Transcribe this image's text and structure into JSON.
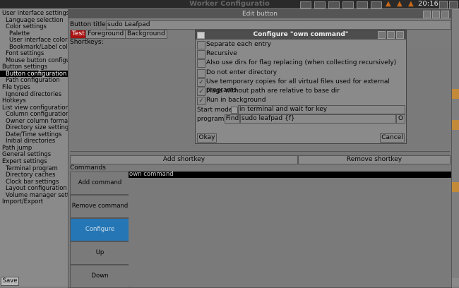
{
  "taskbar": {
    "window_title": "Worker Configuratio",
    "clock": "20:16"
  },
  "worker_config": {
    "tree": [
      {
        "label": "User interface settings",
        "indent": 0
      },
      {
        "label": "Language selection",
        "indent": 1
      },
      {
        "label": "Color settings",
        "indent": 1
      },
      {
        "label": "Palette",
        "indent": 2
      },
      {
        "label": "User interface colors",
        "indent": 2
      },
      {
        "label": "Bookmark/Label colo",
        "indent": 2
      },
      {
        "label": "Font settings",
        "indent": 1
      },
      {
        "label": "Mouse button configu",
        "indent": 1
      },
      {
        "label": "Button settings",
        "indent": 0
      },
      {
        "label": "Button configuration",
        "indent": 1,
        "selected": true
      },
      {
        "label": "Path configuration",
        "indent": 1
      },
      {
        "label": "File types",
        "indent": 0
      },
      {
        "label": "Ignored directories",
        "indent": 1
      },
      {
        "label": "Hotkeys",
        "indent": 0
      },
      {
        "label": "List view configuration",
        "indent": 0
      },
      {
        "label": "Column configuration",
        "indent": 1
      },
      {
        "label": "Owner column forma",
        "indent": 1
      },
      {
        "label": "Directory size setting",
        "indent": 1
      },
      {
        "label": "Date/Time settings",
        "indent": 1
      },
      {
        "label": "Initial directories",
        "indent": 1
      },
      {
        "label": "Path jump",
        "indent": 0
      },
      {
        "label": "General settings",
        "indent": 0
      },
      {
        "label": "Expert settings",
        "indent": 0
      },
      {
        "label": "Terminal program",
        "indent": 1
      },
      {
        "label": "Directory caches",
        "indent": 1
      },
      {
        "label": "Clock bar settings",
        "indent": 1
      },
      {
        "label": "Layout configuration",
        "indent": 1
      },
      {
        "label": "Volume manager sett",
        "indent": 1
      },
      {
        "label": "Import/Export",
        "indent": 0
      }
    ],
    "save_label": "Save"
  },
  "edit_button": {
    "title": "Edit button",
    "button_title_label": "Button title:",
    "button_title_value": "sudo Leafpad",
    "tabs": [
      "Test",
      "Foreground",
      "Background"
    ],
    "shortkeys_label": "Shortkeys:",
    "add_shortkey": "Add shortkey",
    "remove_shortkey": "Remove shortkey",
    "commands_label": "Commands",
    "command_buttons": [
      "Add command",
      "Remove command",
      "Configure",
      "Up",
      "Down"
    ],
    "commands": [
      "own command"
    ]
  },
  "own_command": {
    "title": "Configure \"own command\"",
    "options": [
      {
        "label": "Separate each entry",
        "checked": false
      },
      {
        "label": "Recursive",
        "checked": false
      },
      {
        "label": "Also use dirs for flag replacing (when collecting recursively)",
        "checked": false
      },
      {
        "label": "Do not enter directory",
        "checked": false
      },
      {
        "label": "Use temporary copies for all virtual files used for external programs",
        "checked": true
      },
      {
        "label": "Flags without path are relative to base dir",
        "checked": true
      },
      {
        "label": "Run in background",
        "checked": true
      }
    ],
    "start_mode_label": "Start mode",
    "start_mode_value": "in terminal and wait for key",
    "program_label": "program:",
    "find_label": "Find",
    "program_value": "sudo leafpad {f}",
    "o_label": "O",
    "okay_label": "Okay",
    "cancel_label": "Cancel"
  }
}
